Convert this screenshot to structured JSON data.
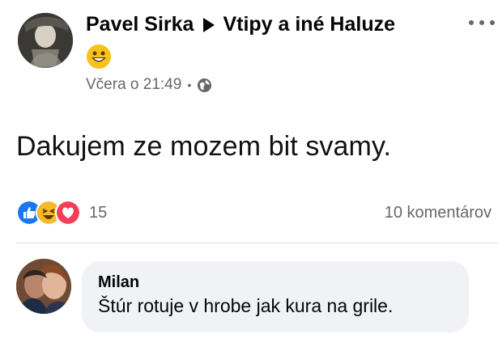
{
  "post": {
    "author": "Pavel Sirka",
    "group": "Vtipy a iné Haluze",
    "time": "Včera o 21:49",
    "text": "Dakujem ze mozem bit svamy.",
    "icons": {
      "avatar": "profile-photo",
      "separator": "right-triangle-icon",
      "emoji": "grinning-face-emoji",
      "privacy": "globe-icon",
      "menu": "more-options-icon"
    }
  },
  "engagement": {
    "reaction_count": "15",
    "comments_label": "10 komentárov",
    "reaction_icons": [
      "like-reaction-icon",
      "haha-reaction-icon",
      "love-reaction-icon"
    ]
  },
  "comment": {
    "name": "Milan",
    "text": "Štúr rotuje v hrobe jak kura na grile."
  },
  "colors": {
    "text": "#050505",
    "muted": "#65676b",
    "like_blue": "#1877f2",
    "love_red": "#f33e58",
    "haha_yellow": "#f7b928",
    "bubble": "#f0f2f5"
  }
}
